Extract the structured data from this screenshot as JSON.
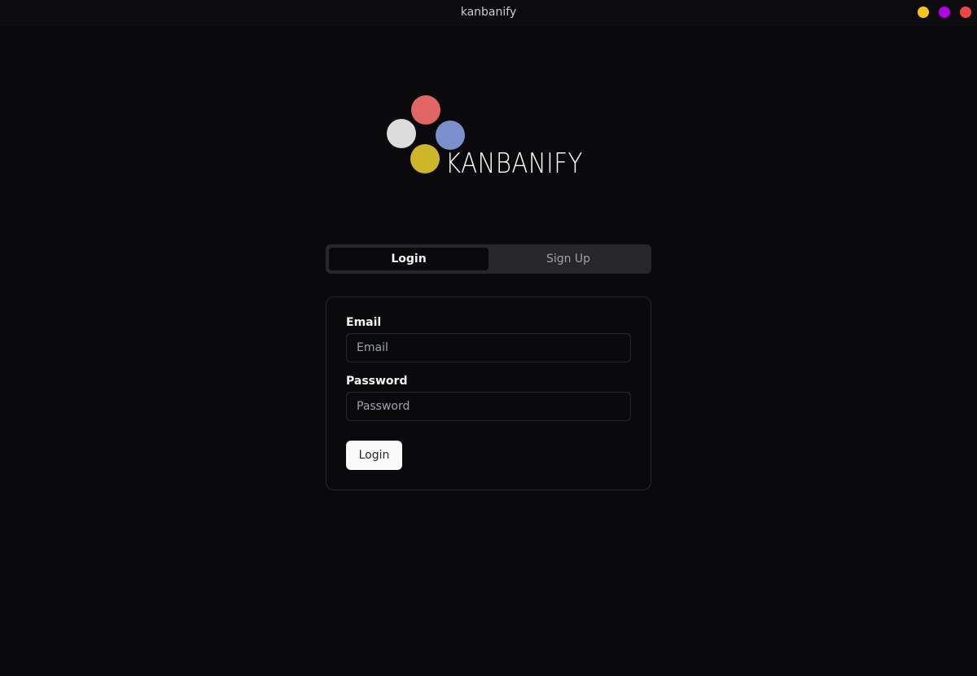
{
  "window": {
    "title": "kanbanify",
    "controls": {
      "minimize_color": "#f5c518",
      "maximize_color": "#b100e8",
      "close_color": "#f04545"
    }
  },
  "logo": {
    "text": "KANBANIFY",
    "dots": {
      "red": "#e06666",
      "white": "#dcdcdc",
      "blue": "#7b8fcd",
      "yellow": "#cdb62a"
    }
  },
  "tabs": [
    {
      "label": "Login",
      "active": true
    },
    {
      "label": "Sign Up",
      "active": false
    }
  ],
  "form": {
    "email": {
      "label": "Email",
      "placeholder": "Email",
      "value": ""
    },
    "password": {
      "label": "Password",
      "placeholder": "Password",
      "value": ""
    },
    "submit_label": "Login"
  }
}
